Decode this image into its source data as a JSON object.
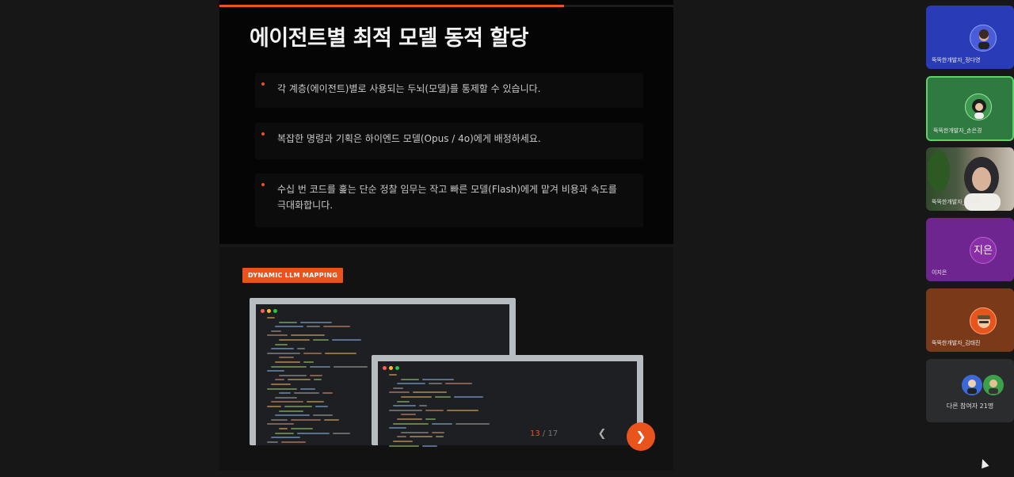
{
  "slide": {
    "title": "에이전트별 최적 모델 동적 할당",
    "progress_fraction": 0.76,
    "bullets": [
      "각 계층(에이전트)별로 사용되는 두뇌(모델)를 통제할 수 있습니다.",
      "복잡한 명령과 기획은 하이엔드 모델(Opus / 4o)에게 배정하세요.",
      "수십 번 코드를 훑는 단순 정찰 임무는 작고 빠른 모델(Flash)에게 맡겨 비용과 속도를 극대화합니다."
    ],
    "badge": "DYNAMIC LLM MAPPING",
    "pager": {
      "current": "13",
      "separator": "/",
      "total": "17"
    },
    "prev_icon": "chevron-left-icon",
    "next_icon": "chevron-right-icon"
  },
  "participants": [
    {
      "name": "뚝뚝한개발자_정다영",
      "kind": "avatar",
      "bg": "#2a3bb8",
      "active": false
    },
    {
      "name": "뚝뚝한개발자_손은경",
      "kind": "avatar",
      "bg": "#2f7a40",
      "active": true
    },
    {
      "name": "뚝뚝한개발자_이지민",
      "kind": "video",
      "bg": "#3c4a3a",
      "active": false
    },
    {
      "name": "이지은",
      "kind": "initials",
      "initials": "지은",
      "bg": "#6e2590",
      "active": false
    },
    {
      "name": "뚝뚝한개발자_김태진",
      "kind": "avatar",
      "bg": "#7a3a1a",
      "active": false
    }
  ],
  "others": {
    "label": "다른 참여자 21명"
  },
  "colors": {
    "accent": "#e8541c",
    "active_border": "#5fd16b"
  }
}
